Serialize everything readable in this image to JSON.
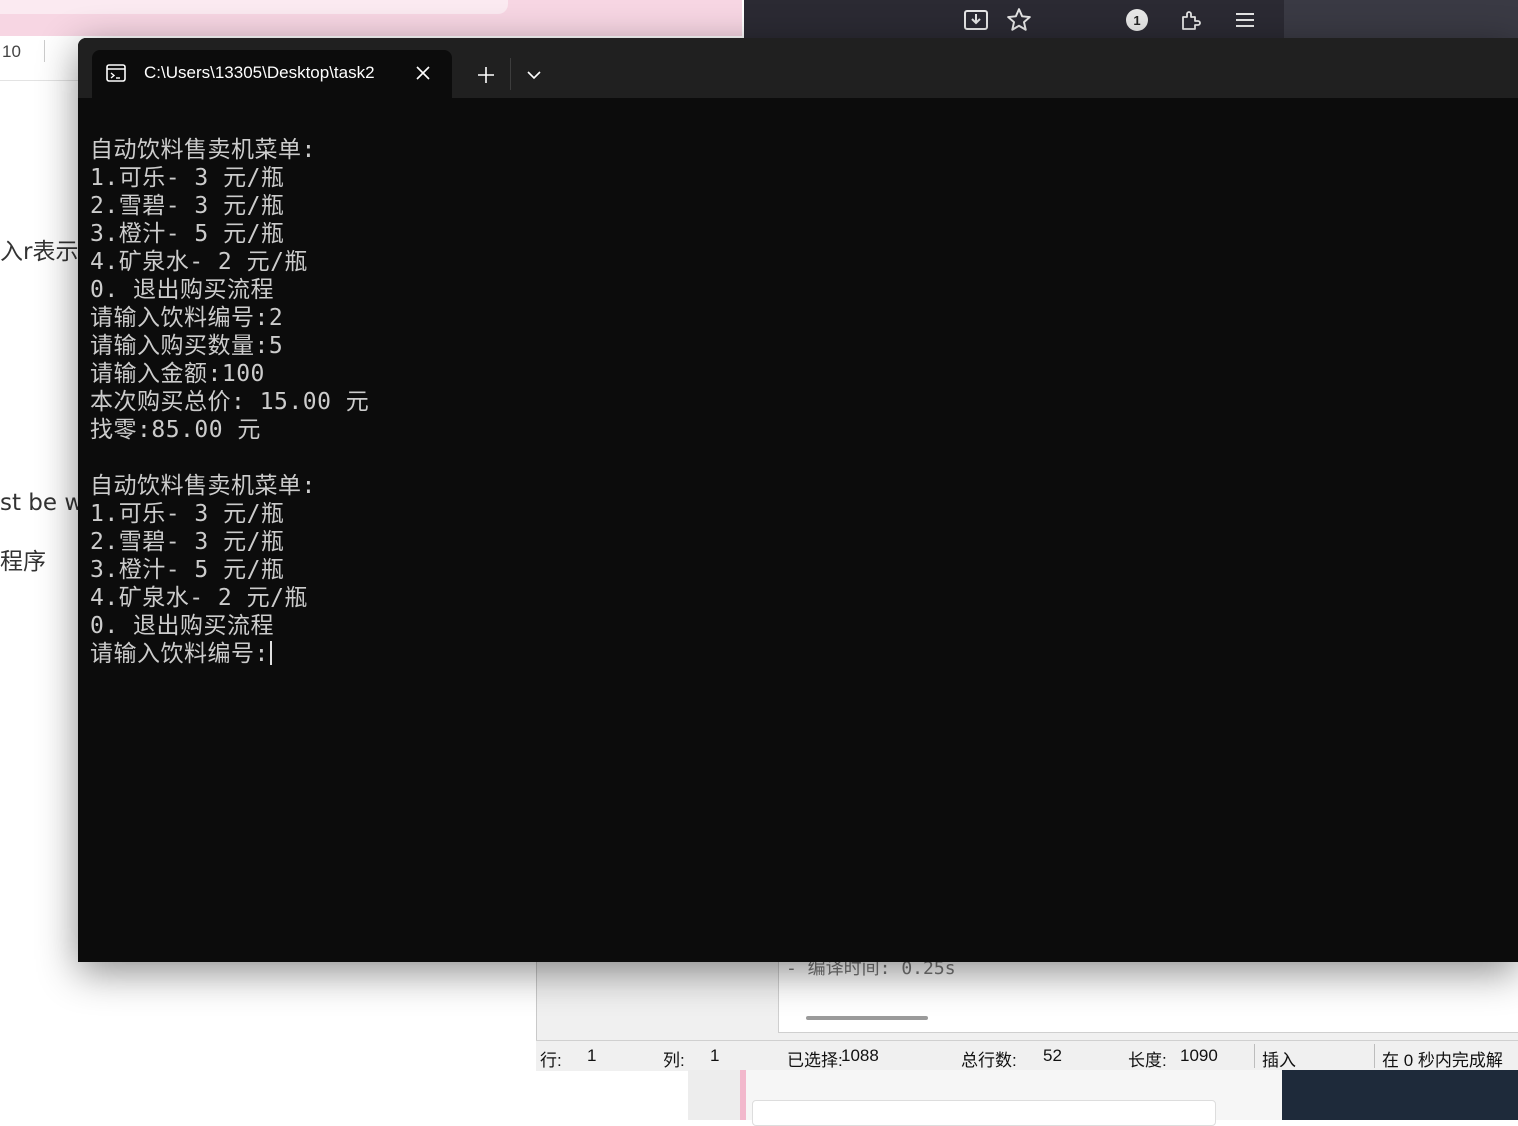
{
  "background_doc": {
    "page_count": "10",
    "line1": "入r表示",
    "line2": "st be wr",
    "line3": "程序"
  },
  "browser_toolbar": {
    "badge_count": "1",
    "icons": [
      "download-icon",
      "star-icon",
      "extension-icon",
      "menu-icon"
    ]
  },
  "terminal": {
    "tab_title": "C:\\Users\\13305\\Desktop\\task2",
    "lines": [
      "自动饮料售卖机菜单:",
      "1.可乐- 3 元/瓶",
      "2.雪碧- 3 元/瓶",
      "3.橙汁- 5 元/瓶",
      "4.矿泉水- 2 元/瓶",
      "0. 退出购买流程",
      "请输入饮料编号:2",
      "请输入购买数量:5",
      "请输入金额:100",
      "本次购买总价: 15.00 元",
      "找零:85.00 元",
      "",
      "自动饮料售卖机菜单:",
      "1.可乐- 3 元/瓶",
      "2.雪碧- 3 元/瓶",
      "3.橙汁- 5 元/瓶",
      "4.矿泉水- 2 元/瓶",
      "0. 退出购买流程"
    ],
    "prompt": "请输入饮料编号:"
  },
  "editor": {
    "compile_text": "- 编译时间: 0.25s",
    "status": {
      "row_label": "行:",
      "row_value": "1",
      "col_label": "列:",
      "col_value": "1",
      "selected_label": "已选择:",
      "selected_value": "1088",
      "total_lines_label": "总行数:",
      "total_lines_value": "52",
      "length_label": "长度:",
      "length_value": "1090",
      "mode": "插入",
      "message": "在 0 秒内完成解"
    }
  }
}
